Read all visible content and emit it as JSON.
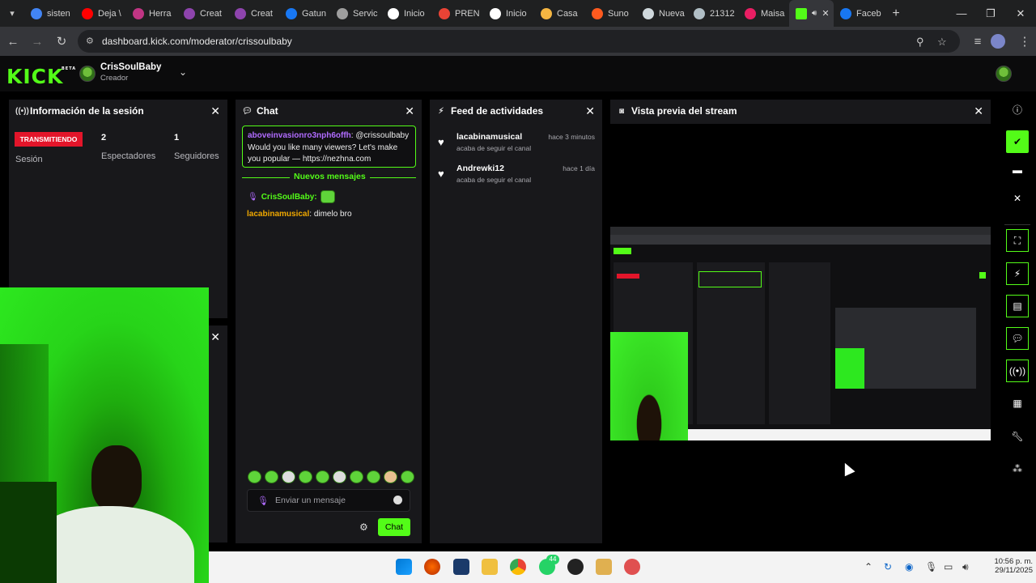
{
  "browser": {
    "tabs": [
      {
        "label": "sisten",
        "color": "#4285f4"
      },
      {
        "label": "Deja \\",
        "color": "#ff0000"
      },
      {
        "label": "Herra",
        "color": "#c13584"
      },
      {
        "label": "Creat",
        "color": "#8e44ad"
      },
      {
        "label": "Creat",
        "color": "#8e44ad"
      },
      {
        "label": "Gatun",
        "color": "#1877f2"
      },
      {
        "label": "Servic",
        "color": "#9e9e9e"
      },
      {
        "label": "Inicio",
        "color": "#ffffff"
      },
      {
        "label": "PREN",
        "color": "#ea4335"
      },
      {
        "label": "Inicio",
        "color": "#ffffff"
      },
      {
        "label": "Casa",
        "color": "#f5b642"
      },
      {
        "label": "Suno",
        "color": "#ff5a1f"
      },
      {
        "label": "Nueva",
        "color": "#cfd8dc"
      },
      {
        "label": "21312",
        "color": "#b0bec5"
      },
      {
        "label": "Maisa",
        "color": "#e91e63"
      }
    ],
    "active_tab": {
      "label": "",
      "color": "#53fc18"
    },
    "last_tab": {
      "label": "Faceb",
      "color": "#1877f2"
    },
    "url": "dashboard.kick.com/moderator/crissoulbaby"
  },
  "kick": {
    "logo": "KICK",
    "logo_sup": "BETA",
    "user_name": "CrisSoulBaby",
    "user_role": "Creador",
    "brand_color": "#53fc18"
  },
  "session": {
    "title": "Información de la sesión",
    "status": "TRANSMITIENDO",
    "session_label": "Sesión",
    "viewers_value": "2",
    "viewers_label": "Espectadores",
    "followers_value": "1",
    "followers_label": "Seguidores"
  },
  "chat": {
    "title": "Chat",
    "pinned_user": "aboveinvasionro3nph6offh",
    "pinned_text": ": @crissoulbaby Would you like many viewers? Let's make you popular — https://nezhna.com",
    "new_messages": "Nuevos mensajes",
    "msg1_user": "CrisSoulBaby:",
    "msg2_user": "lacabinamusical",
    "msg2_text": ": dimelo bro",
    "input_placeholder": "Enviar un mensaje",
    "send_label": "Chat"
  },
  "feed": {
    "title": "Feed de actividades",
    "items": [
      {
        "user": "lacabinamusical",
        "action": "acaba de seguir el canal",
        "time": "hace 3 minutos"
      },
      {
        "user": "Andrewki12",
        "action": "acaba de seguir el canal",
        "time": "hace 1 día"
      }
    ]
  },
  "preview": {
    "title": "Vista previa del stream"
  },
  "taskbar": {
    "time": "10:56 p. m.",
    "date": "29/11/2025",
    "badge": "44"
  }
}
